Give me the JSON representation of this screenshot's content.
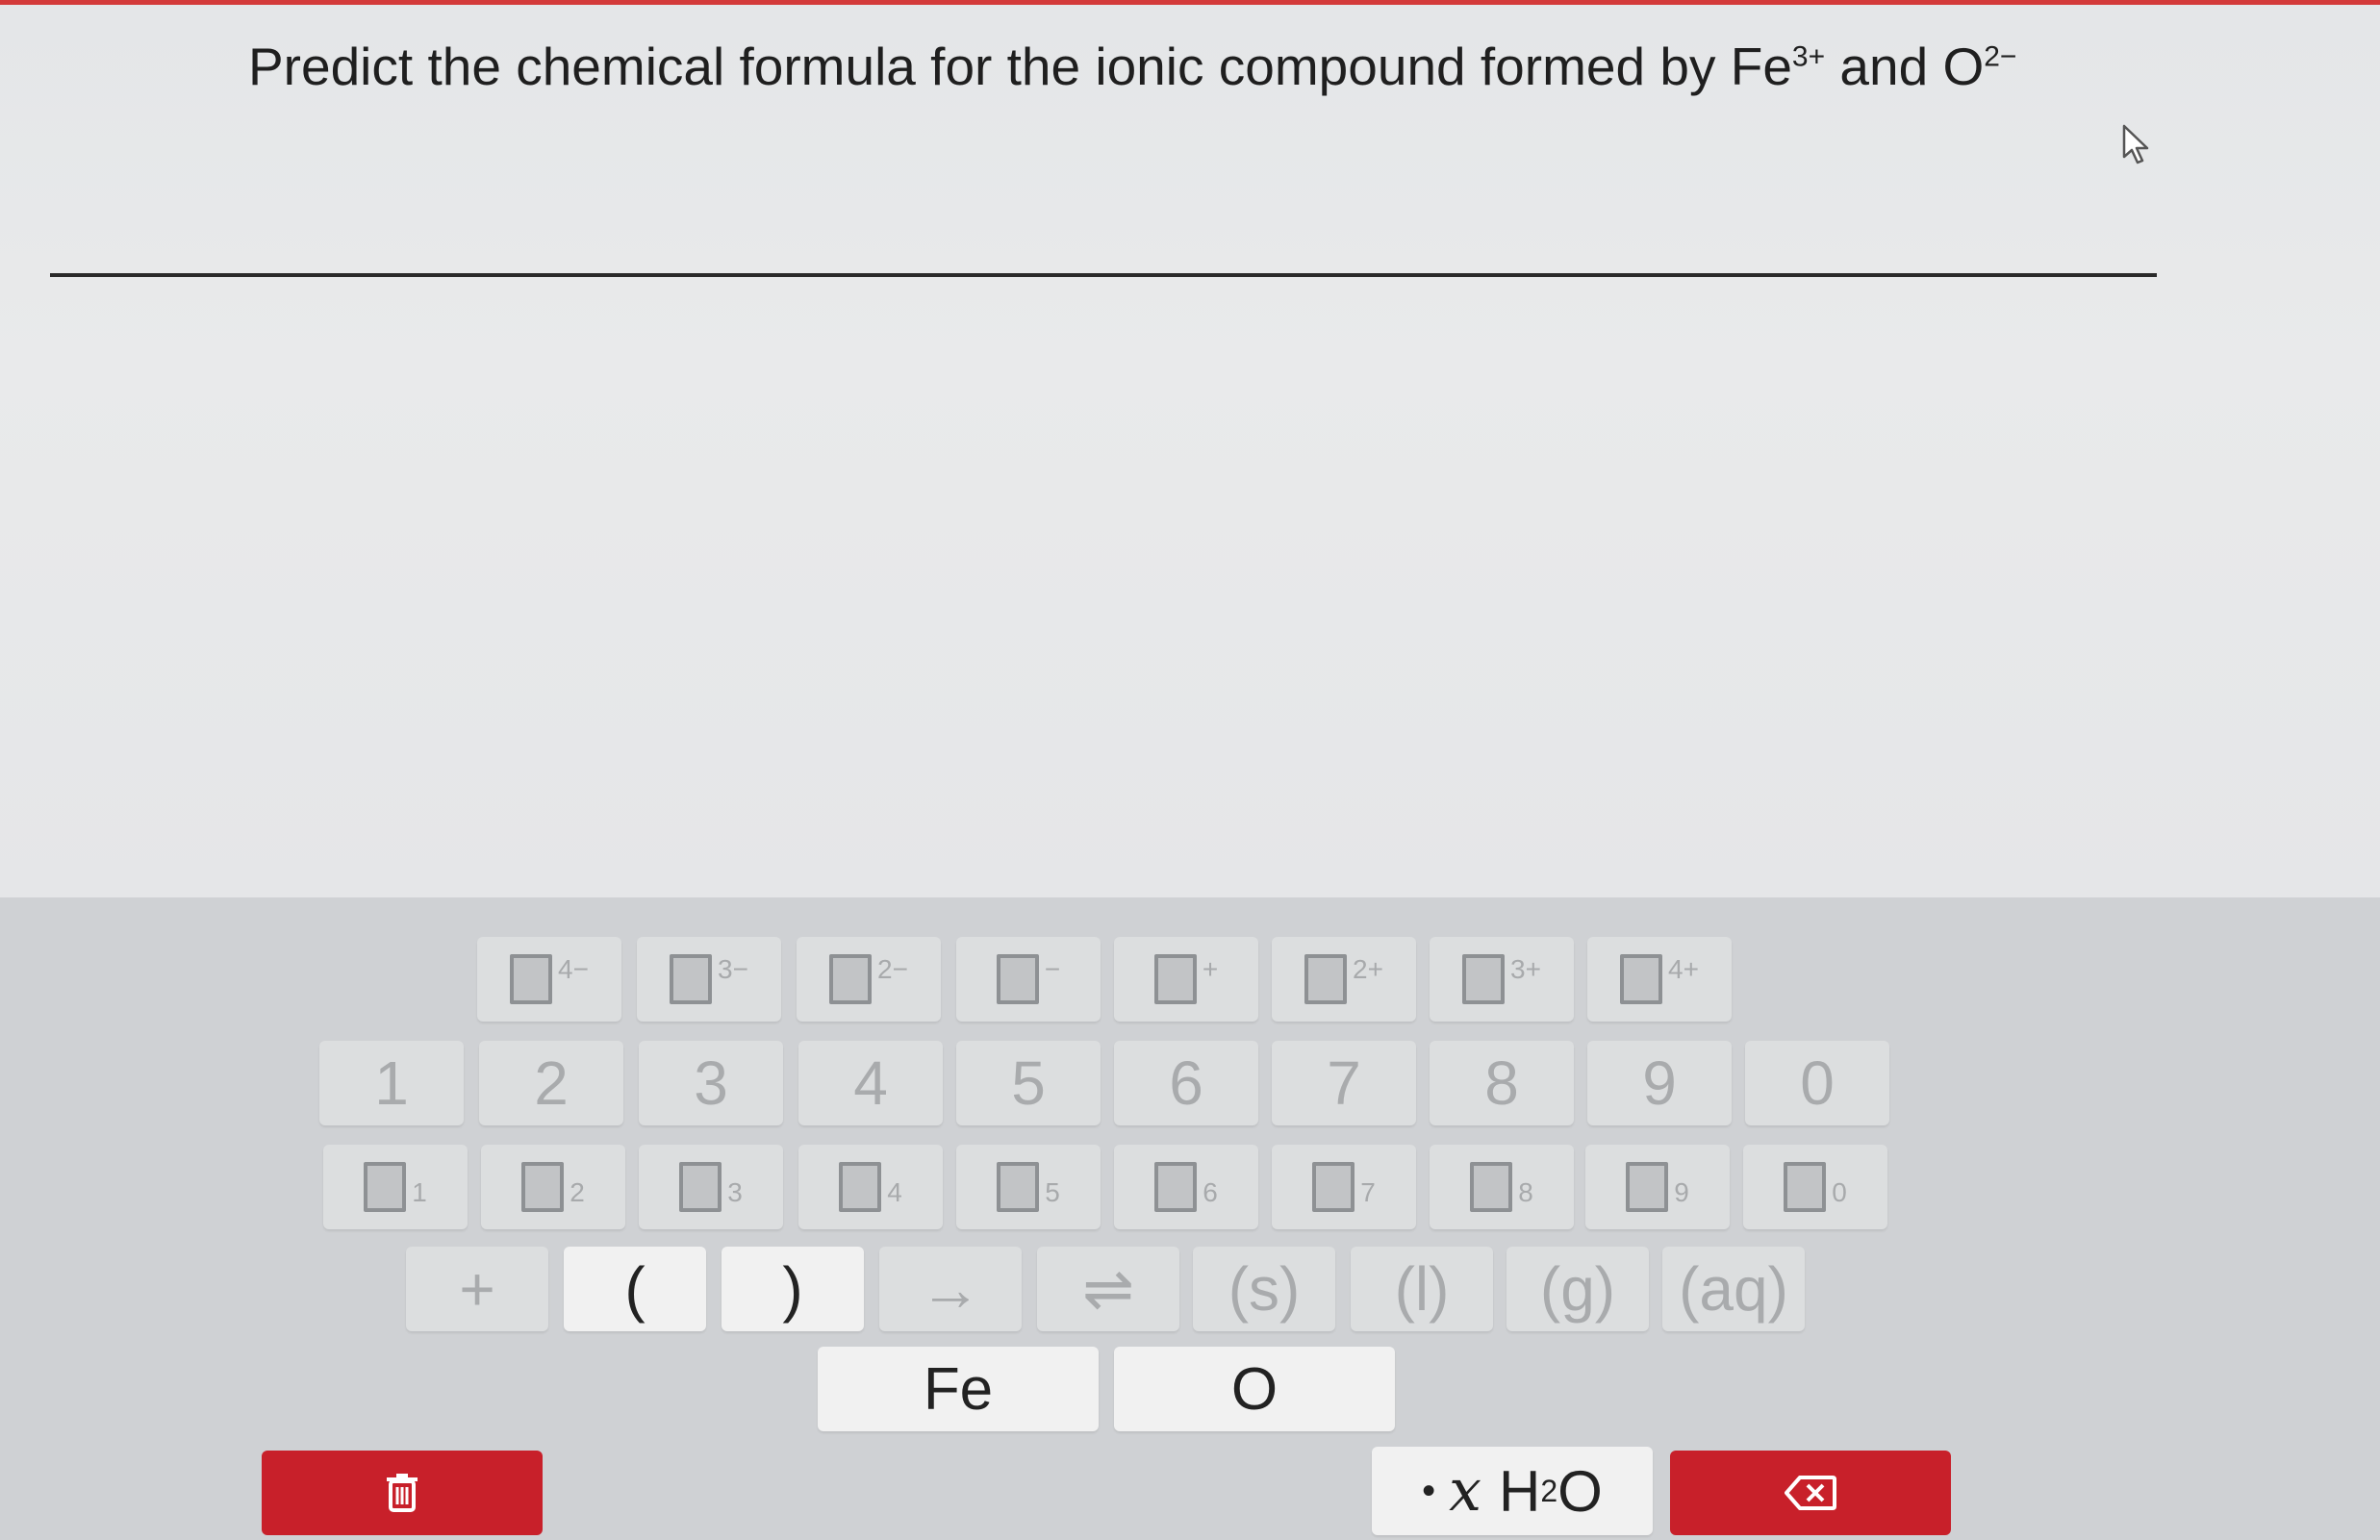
{
  "question": {
    "prefix": "Predict the chemical formula for the ionic compound formed by Fe",
    "ion1_charge": "3+",
    "middle": " and O",
    "ion2_charge": "2−"
  },
  "charge_keys": [
    "4−",
    "3−",
    "2−",
    "−",
    "+",
    "2+",
    "3+",
    "4+"
  ],
  "digit_keys": [
    "1",
    "2",
    "3",
    "4",
    "5",
    "6",
    "7",
    "8",
    "9",
    "0"
  ],
  "subscript_keys": [
    "1",
    "2",
    "3",
    "4",
    "5",
    "6",
    "7",
    "8",
    "9",
    "0"
  ],
  "symbol_keys": [
    "+",
    "(",
    ")",
    "→",
    "⇌",
    "(s)",
    "(l)",
    "(g)",
    "(aq)"
  ],
  "element_keys": [
    "Fe",
    "O"
  ],
  "hydrate_key": {
    "dot": "•",
    "x": "x",
    "h": "H",
    "sub": "2",
    "o": "O"
  },
  "colors": {
    "accent_red": "#c8202a",
    "top_bar": "#d33a3a"
  },
  "icons": {
    "clear": "trash-icon",
    "backspace": "backspace-icon",
    "cursor": "mouse-cursor-icon"
  }
}
